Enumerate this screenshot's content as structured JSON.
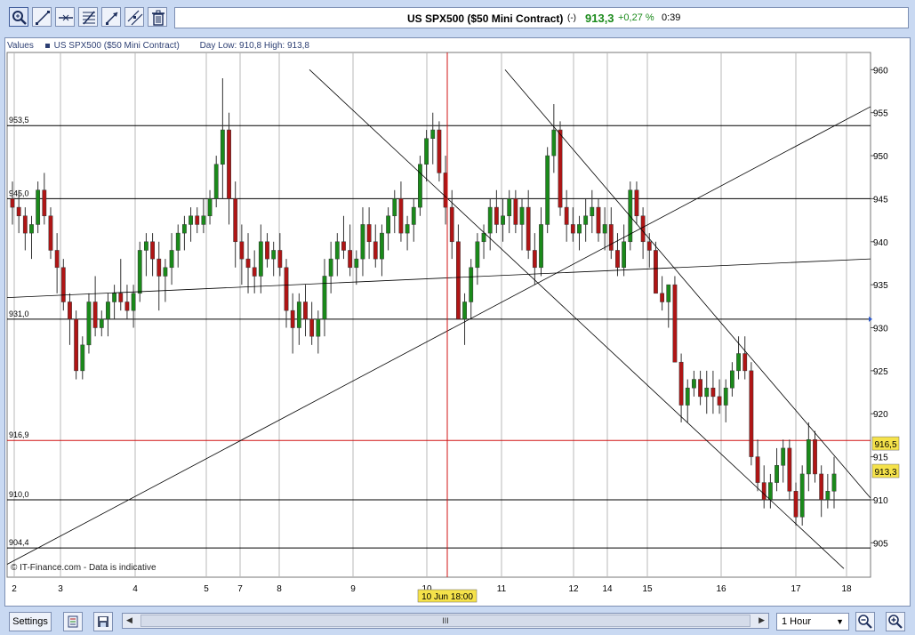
{
  "toolbar": {
    "icons": [
      "zoom-tool-icon",
      "line-tool-icon",
      "horizontal-line-icon",
      "fibonacci-icon",
      "arrow-tool-icon",
      "parallel-tool-icon",
      "trash-icon"
    ]
  },
  "header": {
    "title": "US SPX500 ($50 Mini Contract)",
    "change_indicator": "(-)",
    "last_price": "913,3",
    "change_pct": "+0,27 %",
    "time": "0:39"
  },
  "legend": {
    "values_label": "Values",
    "series_label": "US SPX500 ($50 Mini Contract)",
    "day_range": "Day Low: 910,8 High: 913,8"
  },
  "watermark": "© IT-Finance.com - Data is indicative",
  "bottom": {
    "settings_label": "Settings",
    "scroll_grip": "III",
    "timeframe": "1 Hour"
  },
  "colors": {
    "up": "#1a8a1a",
    "down": "#b01515",
    "price_tag": "#f5e24a",
    "crosshair": "#d01515"
  },
  "chart_data": {
    "type": "candlestick",
    "title": "US SPX500 ($50 Mini Contract)",
    "ylim": [
      901,
      962
    ],
    "y_ticks": [
      905,
      910,
      915,
      920,
      925,
      930,
      935,
      940,
      945,
      950,
      955,
      960
    ],
    "x_ticks": [
      "2",
      "3",
      "4",
      "5",
      "7",
      "8",
      "9",
      "10",
      "11",
      "12",
      "14",
      "15",
      "16",
      "17",
      "18"
    ],
    "h_levels": [
      {
        "label": "953,5",
        "value": 953.5
      },
      {
        "label": "945,0",
        "value": 945.0
      },
      {
        "label": "931,0",
        "value": 931.0
      },
      {
        "label": "916,9",
        "value": 916.9
      },
      {
        "label": "910,0",
        "value": 910.0
      },
      {
        "label": "904,4",
        "value": 904.4
      }
    ],
    "price_tags": [
      {
        "label": "916,5",
        "value": 916.5
      },
      {
        "label": "913,3",
        "value": 913.3
      }
    ],
    "crosshair": {
      "label": "10 Jun 18:00",
      "value": 916.5,
      "date": "10 Jun 18:00"
    },
    "trendlines": [
      {
        "from": [
          0,
          933.5
        ],
        "to": [
          971,
          938.0
        ]
      },
      {
        "from": [
          0,
          902.5
        ],
        "to": [
          971,
          955.7
        ]
      },
      {
        "from": [
          340,
          960.0
        ],
        "to": [
          941,
          902.0
        ]
      },
      {
        "from": [
          560,
          960.0
        ],
        "to": [
          971,
          910.2
        ]
      }
    ],
    "candles": [
      [
        945,
        947,
        942,
        944
      ],
      [
        944,
        946,
        941,
        943
      ],
      [
        943,
        944,
        939,
        941
      ],
      [
        941,
        943,
        938,
        942
      ],
      [
        942,
        947,
        941,
        946
      ],
      [
        946,
        948,
        942,
        943
      ],
      [
        943,
        944,
        938,
        939
      ],
      [
        939,
        941,
        934,
        937
      ],
      [
        937,
        938,
        932,
        933
      ],
      [
        933,
        934,
        928,
        931
      ],
      [
        931,
        932,
        924,
        925
      ],
      [
        925,
        929,
        924,
        928
      ],
      [
        928,
        934,
        927,
        933
      ],
      [
        933,
        936,
        929,
        930
      ],
      [
        930,
        932,
        929,
        931
      ],
      [
        931,
        934,
        929,
        933
      ],
      [
        933,
        935,
        931,
        934
      ],
      [
        934,
        938,
        932,
        933
      ],
      [
        933,
        935,
        931,
        932
      ],
      [
        932,
        935,
        930,
        934
      ],
      [
        934,
        940,
        933,
        939
      ],
      [
        939,
        941,
        936,
        940
      ],
      [
        940,
        941,
        936,
        938
      ],
      [
        938,
        940,
        932,
        936
      ],
      [
        936,
        938,
        933,
        937
      ],
      [
        937,
        941,
        935,
        939
      ],
      [
        939,
        942,
        937,
        941
      ],
      [
        941,
        943,
        939,
        942
      ],
      [
        942,
        944,
        940,
        943
      ],
      [
        943,
        944,
        941,
        942
      ],
      [
        942,
        945,
        941,
        943
      ],
      [
        943,
        946,
        942,
        945
      ],
      [
        945,
        950,
        944,
        949
      ],
      [
        949,
        959,
        945,
        953
      ],
      [
        953,
        955,
        942,
        945
      ],
      [
        945,
        947,
        937,
        940
      ],
      [
        940,
        942,
        935,
        938
      ],
      [
        938,
        941,
        934,
        937
      ],
      [
        937,
        939,
        934,
        936
      ],
      [
        936,
        942,
        934,
        940
      ],
      [
        940,
        941,
        937,
        938
      ],
      [
        938,
        940,
        936,
        939
      ],
      [
        939,
        941,
        936,
        937
      ],
      [
        937,
        938,
        930,
        932
      ],
      [
        932,
        934,
        927,
        930
      ],
      [
        930,
        934,
        928,
        933
      ],
      [
        933,
        935,
        929,
        931
      ],
      [
        931,
        933,
        928,
        929
      ],
      [
        929,
        932,
        927,
        931
      ],
      [
        931,
        938,
        929,
        936
      ],
      [
        936,
        940,
        934,
        938
      ],
      [
        938,
        941,
        936,
        940
      ],
      [
        940,
        943,
        938,
        939
      ],
      [
        939,
        942,
        936,
        937
      ],
      [
        937,
        939,
        935,
        938
      ],
      [
        938,
        944,
        936,
        942
      ],
      [
        942,
        944,
        938,
        940
      ],
      [
        940,
        942,
        937,
        938
      ],
      [
        938,
        942,
        936,
        941
      ],
      [
        941,
        944,
        939,
        943
      ],
      [
        943,
        946,
        941,
        945
      ],
      [
        945,
        947,
        940,
        941
      ],
      [
        941,
        943,
        939,
        942
      ],
      [
        942,
        945,
        940,
        944
      ],
      [
        944,
        950,
        943,
        949
      ],
      [
        949,
        953,
        947,
        952
      ],
      [
        952,
        955,
        949,
        953
      ],
      [
        953,
        954,
        947,
        948
      ],
      [
        948,
        950,
        942,
        944
      ],
      [
        944,
        946,
        938,
        940
      ],
      [
        940,
        942,
        932,
        931
      ],
      [
        931,
        934,
        928,
        933
      ],
      [
        933,
        938,
        931,
        937
      ],
      [
        937,
        941,
        935,
        940
      ],
      [
        940,
        942,
        938,
        941
      ],
      [
        941,
        945,
        939,
        944
      ],
      [
        944,
        946,
        941,
        942
      ],
      [
        942,
        945,
        940,
        943
      ],
      [
        943,
        946,
        941,
        945
      ],
      [
        945,
        946,
        941,
        942
      ],
      [
        942,
        945,
        939,
        944
      ],
      [
        944,
        946,
        938,
        939
      ],
      [
        939,
        941,
        935,
        937
      ],
      [
        937,
        944,
        936,
        942
      ],
      [
        942,
        951,
        941,
        950
      ],
      [
        950,
        956,
        948,
        953
      ],
      [
        953,
        954,
        943,
        944
      ],
      [
        944,
        946,
        940,
        942
      ],
      [
        942,
        944,
        940,
        941
      ],
      [
        941,
        943,
        939,
        942
      ],
      [
        942,
        945,
        940,
        943
      ],
      [
        943,
        946,
        941,
        944
      ],
      [
        944,
        945,
        940,
        941
      ],
      [
        941,
        944,
        939,
        942
      ],
      [
        942,
        944,
        938,
        939
      ],
      [
        939,
        941,
        936,
        937
      ],
      [
        937,
        942,
        936,
        940
      ],
      [
        940,
        947,
        939,
        946
      ],
      [
        946,
        947,
        942,
        943
      ],
      [
        943,
        944,
        938,
        940
      ],
      [
        940,
        941,
        937,
        939
      ],
      [
        939,
        940,
        934,
        934
      ],
      [
        934,
        936,
        932,
        933
      ],
      [
        933,
        935,
        930,
        935
      ],
      [
        935,
        936,
        926,
        926
      ],
      [
        926,
        927,
        919,
        921
      ],
      [
        921,
        924,
        919,
        923
      ],
      [
        923,
        925,
        922,
        924
      ],
      [
        924,
        925,
        921,
        922
      ],
      [
        922,
        925,
        920,
        923
      ],
      [
        923,
        925,
        920,
        922
      ],
      [
        922,
        924,
        920,
        921
      ],
      [
        921,
        924,
        919,
        923
      ],
      [
        923,
        926,
        922,
        925
      ],
      [
        925,
        929,
        924,
        927
      ],
      [
        927,
        929,
        924,
        925
      ],
      [
        925,
        926,
        914,
        915
      ],
      [
        915,
        917,
        911,
        912
      ],
      [
        912,
        914,
        909,
        910
      ],
      [
        910,
        913,
        909,
        912
      ],
      [
        912,
        916,
        911,
        914
      ],
      [
        914,
        917,
        912,
        916
      ],
      [
        916,
        917,
        910,
        911
      ],
      [
        911,
        912,
        907,
        908
      ],
      [
        908,
        914,
        907,
        913
      ],
      [
        913,
        919,
        911,
        917
      ],
      [
        917,
        918,
        912,
        913
      ],
      [
        913,
        914,
        908,
        910
      ],
      [
        910,
        913,
        909,
        911
      ],
      [
        911,
        915,
        909,
        913
      ]
    ]
  }
}
